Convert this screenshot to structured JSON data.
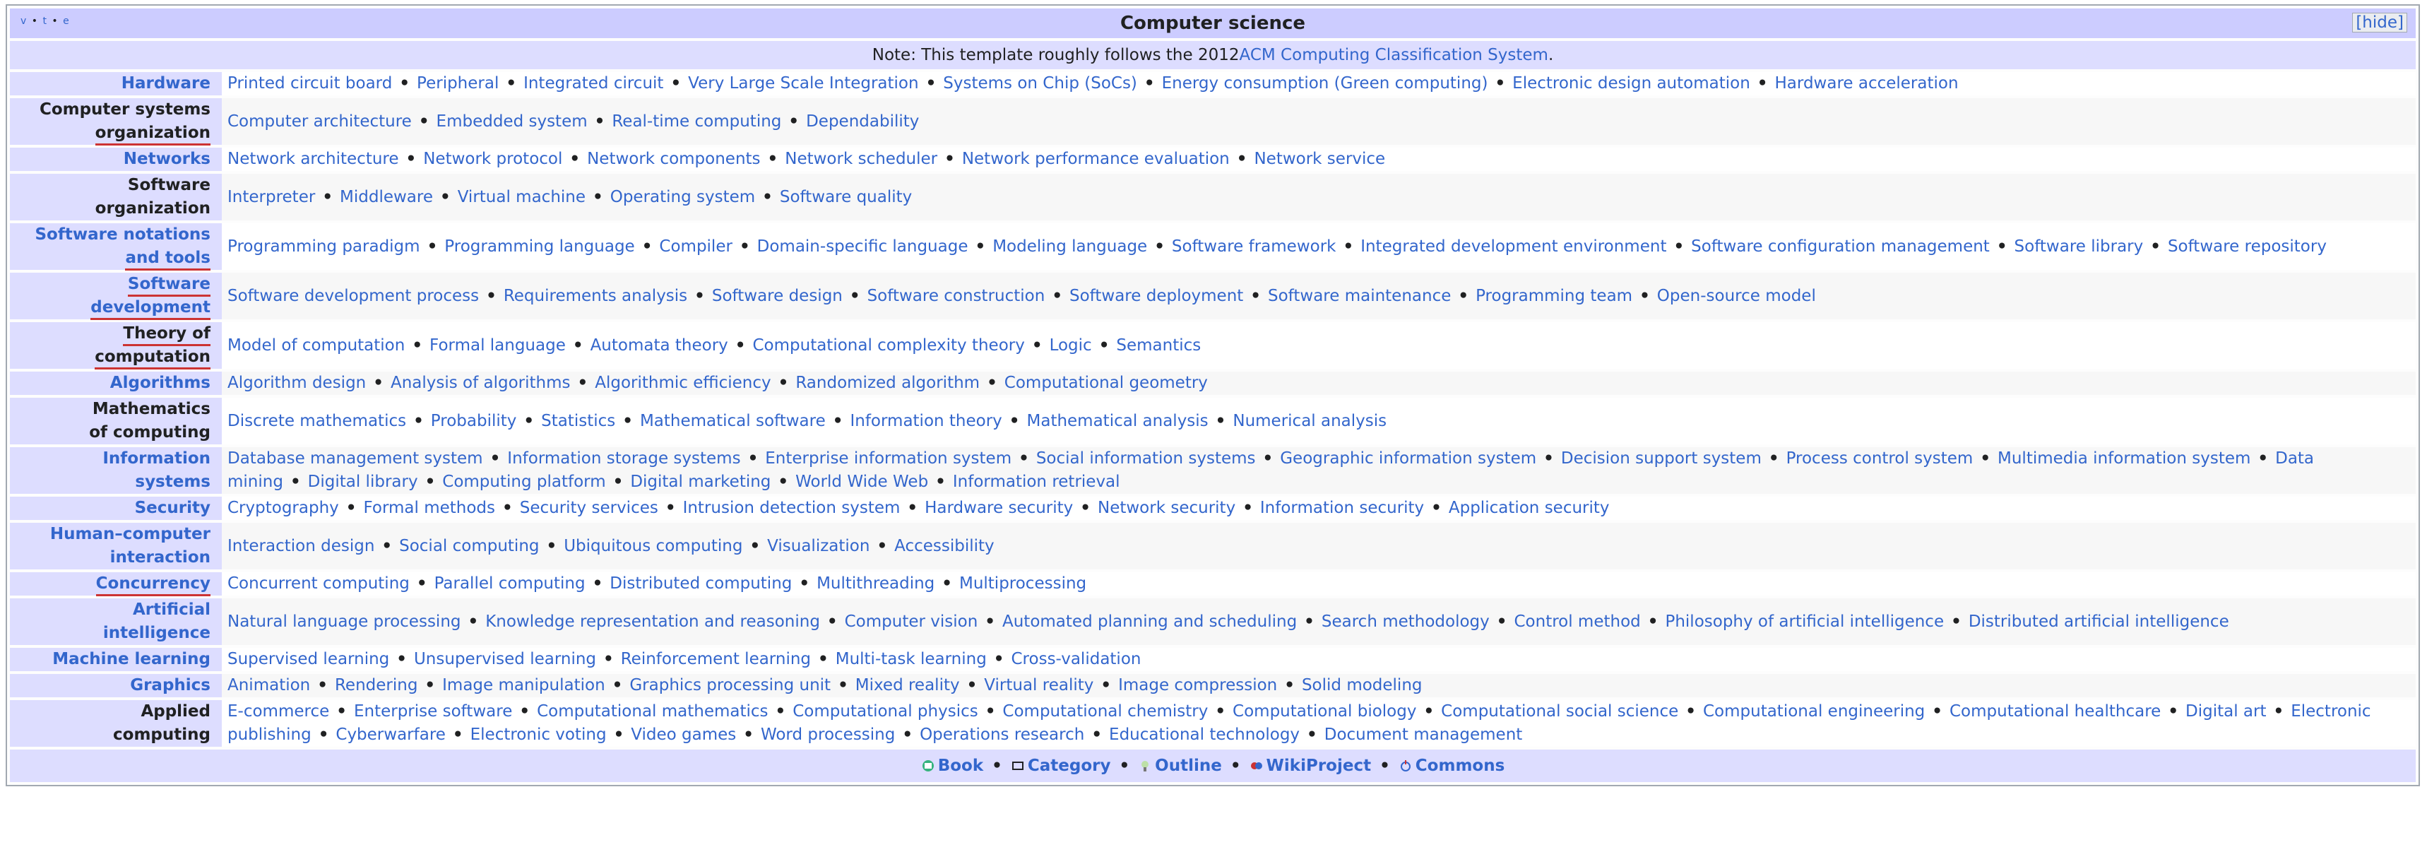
{
  "navbox": {
    "vte": [
      "v",
      "t",
      "e"
    ],
    "title": "Computer science",
    "hide_label": "[hide]",
    "note_prefix": "Note: This template roughly follows the 2012 ",
    "note_link": "ACM Computing Classification System",
    "note_suffix": ".",
    "rows": [
      {
        "group": [
          "Hardware"
        ],
        "link": true,
        "items": [
          "Printed circuit board",
          "Peripheral",
          "Integrated circuit",
          "Very Large Scale Integration",
          "Systems on Chip (SoCs)",
          "Energy consumption (Green computing)",
          "Electronic design automation",
          "Hardware acceleration"
        ]
      },
      {
        "group": [
          "Computer systems",
          "organization"
        ],
        "link": false,
        "underline": true,
        "items": [
          "Computer architecture",
          "Embedded system",
          "Real-time computing",
          "Dependability"
        ]
      },
      {
        "group": [
          "Networks"
        ],
        "link": true,
        "items": [
          "Network architecture",
          "Network protocol",
          "Network components",
          "Network scheduler",
          "Network performance evaluation",
          "Network service"
        ]
      },
      {
        "group": [
          "Software organization"
        ],
        "link": false,
        "items": [
          "Interpreter",
          "Middleware",
          "Virtual machine",
          "Operating system",
          "Software quality"
        ]
      },
      {
        "group": [
          "Software notations",
          "and tools"
        ],
        "link": true,
        "underline": true,
        "items": [
          "Programming paradigm",
          "Programming language",
          "Compiler",
          "Domain-specific language",
          "Modeling language",
          "Software framework",
          "Integrated development environment",
          "Software configuration management",
          "Software library",
          "Software repository"
        ]
      },
      {
        "group": [
          "Software development"
        ],
        "link": true,
        "underline": true,
        "items": [
          "Software development process",
          "Requirements analysis",
          "Software design",
          "Software construction",
          "Software deployment",
          "Software maintenance",
          "Programming team",
          "Open-source model"
        ]
      },
      {
        "group": [
          "Theory of computation"
        ],
        "link": false,
        "underline": true,
        "items": [
          "Model of computation",
          "Formal language",
          "Automata theory",
          "Computational complexity theory",
          "Logic",
          "Semantics"
        ]
      },
      {
        "group": [
          "Algorithms"
        ],
        "link": true,
        "items": [
          "Algorithm design",
          "Analysis of algorithms",
          "Algorithmic efficiency",
          "Randomized algorithm",
          "Computational geometry"
        ]
      },
      {
        "group": [
          "Mathematics",
          "of computing"
        ],
        "link": false,
        "items": [
          "Discrete mathematics",
          "Probability",
          "Statistics",
          "Mathematical software",
          "Information theory",
          "Mathematical analysis",
          "Numerical analysis"
        ]
      },
      {
        "group": [
          "Information",
          "systems"
        ],
        "link": true,
        "items": [
          "Database management system",
          "Information storage systems",
          "Enterprise information system",
          "Social information systems",
          "Geographic information system",
          "Decision support system",
          "Process control system",
          "Multimedia information system",
          "Data mining",
          "Digital library",
          "Computing platform",
          "Digital marketing",
          "World Wide Web",
          "Information retrieval"
        ]
      },
      {
        "group": [
          "Security"
        ],
        "link": true,
        "items": [
          "Cryptography",
          "Formal methods",
          "Security services",
          "Intrusion detection system",
          "Hardware security",
          "Network security",
          "Information security",
          "Application security"
        ]
      },
      {
        "group": [
          "Human–computer",
          "interaction"
        ],
        "link": true,
        "items": [
          "Interaction design",
          "Social computing",
          "Ubiquitous computing",
          "Visualization",
          "Accessibility"
        ]
      },
      {
        "group": [
          "Concurrency"
        ],
        "link": true,
        "underline": true,
        "items": [
          "Concurrent computing",
          "Parallel computing",
          "Distributed computing",
          "Multithreading",
          "Multiprocessing"
        ]
      },
      {
        "group": [
          "Artificial",
          "intelligence"
        ],
        "link": true,
        "items": [
          "Natural language processing",
          "Knowledge representation and reasoning",
          "Computer vision",
          "Automated planning and scheduling",
          "Search methodology",
          "Control method",
          "Philosophy of artificial intelligence",
          "Distributed artificial intelligence"
        ]
      },
      {
        "group": [
          "Machine learning"
        ],
        "link": true,
        "items": [
          "Supervised learning",
          "Unsupervised learning",
          "Reinforcement learning",
          "Multi-task learning",
          "Cross-validation"
        ]
      },
      {
        "group": [
          "Graphics"
        ],
        "link": true,
        "items": [
          "Animation",
          "Rendering",
          "Image manipulation",
          "Graphics processing unit",
          "Mixed reality",
          "Virtual reality",
          "Image compression",
          "Solid modeling"
        ]
      },
      {
        "group": [
          "Applied",
          "computing"
        ],
        "link": false,
        "items": [
          "E-commerce",
          "Enterprise software",
          "Computational mathematics",
          "Computational physics",
          "Computational chemistry",
          "Computational biology",
          "Computational social science",
          "Computational engineering",
          "Computational healthcare",
          "Digital art",
          "Electronic publishing",
          "Cyberwarfare",
          "Electronic voting",
          "Video games",
          "Word processing",
          "Operations research",
          "Educational technology",
          "Document management"
        ]
      }
    ],
    "footer": [
      {
        "label": "Book",
        "icon": "book-icon"
      },
      {
        "label": "Category",
        "icon": "category-icon"
      },
      {
        "label": "Outline",
        "icon": "outline-icon"
      },
      {
        "label": "WikiProject",
        "icon": "wikiproject-icon"
      },
      {
        "label": "Commons",
        "icon": "commons-icon"
      }
    ],
    "colors": {
      "link": "#3366cc",
      "title_bg": "#ccccff",
      "group_bg": "#ddddff"
    }
  }
}
